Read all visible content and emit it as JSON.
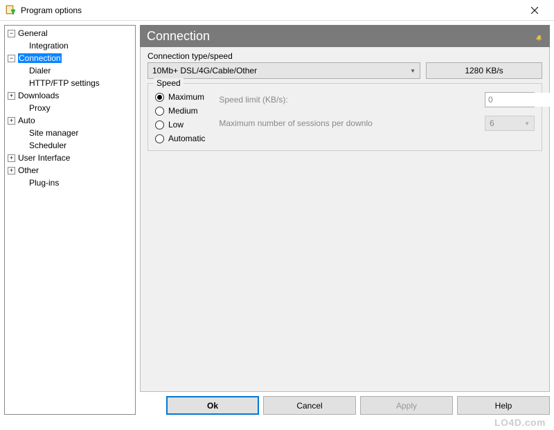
{
  "window": {
    "title": "Program options"
  },
  "tree": {
    "general": {
      "label": "General",
      "expanded": true
    },
    "integration": {
      "label": "Integration"
    },
    "connection": {
      "label": "Connection",
      "expanded": true
    },
    "dialer": {
      "label": "Dialer"
    },
    "http_ftp": {
      "label": "HTTP/FTP settings"
    },
    "downloads": {
      "label": "Downloads",
      "expanded": false
    },
    "proxy": {
      "label": "Proxy"
    },
    "auto": {
      "label": "Auto",
      "expanded": false
    },
    "site_manager": {
      "label": "Site manager"
    },
    "scheduler": {
      "label": "Scheduler"
    },
    "user_interface": {
      "label": "User Interface",
      "expanded": false
    },
    "other": {
      "label": "Other",
      "expanded": false
    },
    "plugins": {
      "label": "Plug-ins"
    }
  },
  "header": {
    "title": "Connection"
  },
  "connection": {
    "type_label": "Connection type/speed",
    "type_value": "10Mb+ DSL/4G/Cable/Other",
    "speed_display": "1280 KB/s"
  },
  "speed": {
    "legend": "Speed",
    "options": {
      "max": "Maximum",
      "med": "Medium",
      "low": "Low",
      "auto": "Automatic"
    },
    "limit_label": "Speed limit (KB/s):",
    "limit_value": "0",
    "sessions_label": "Maximum number of sessions per downlo",
    "sessions_value": "6"
  },
  "buttons": {
    "ok": "Ok",
    "cancel": "Cancel",
    "apply": "Apply",
    "help": "Help"
  },
  "watermark": "LO4D.com"
}
